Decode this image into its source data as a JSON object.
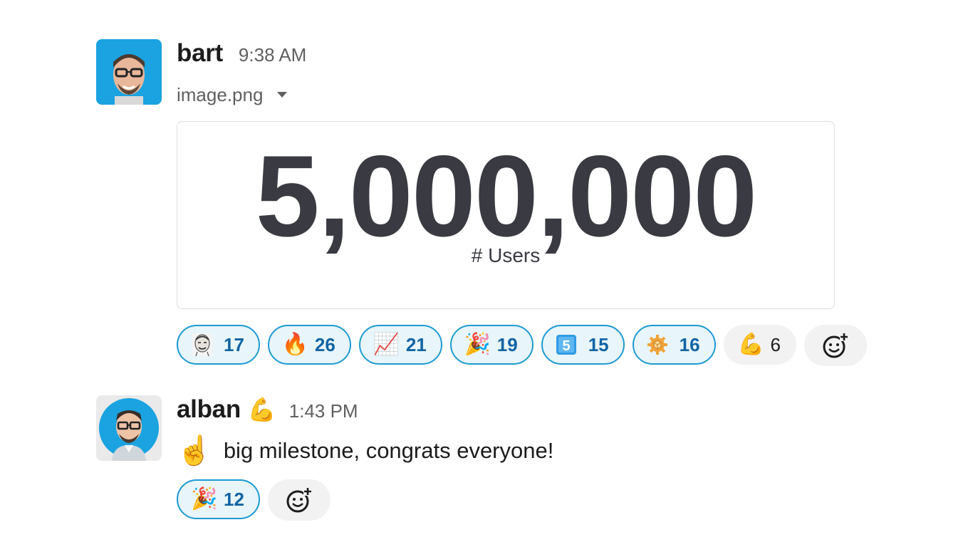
{
  "messages": [
    {
      "username": "bart",
      "time": "9:38 AM",
      "file_name": "image.png",
      "image": {
        "number": "5,000,000",
        "label": "# Users"
      },
      "reactions": [
        {
          "emoji": "meme-face",
          "count": "17",
          "active": true
        },
        {
          "emoji": "🔥",
          "count": "26",
          "active": true
        },
        {
          "emoji": "📈",
          "count": "21",
          "active": true
        },
        {
          "emoji": "🎉",
          "count": "19",
          "active": true
        },
        {
          "emoji": "5️⃣",
          "count": "15",
          "active": true
        },
        {
          "emoji": "sentry-gear",
          "count": "16",
          "active": true
        },
        {
          "emoji": "💪",
          "count": "6",
          "active": false
        }
      ]
    },
    {
      "username": "alban",
      "status_emoji": "💪",
      "time": "1:43 PM",
      "body_emoji": "☝️",
      "body": "big milestone, congrats everyone!",
      "reactions": [
        {
          "emoji": "🎉",
          "count": "12",
          "active": true
        }
      ]
    }
  ],
  "colors": {
    "accent": "#1d9bd1",
    "accent_bg": "#e8f5fa",
    "link": "#1264a3",
    "avatar_bg": "#1aa3e0"
  },
  "icons": [
    "add-reaction-icon",
    "dropdown-caret-icon"
  ]
}
